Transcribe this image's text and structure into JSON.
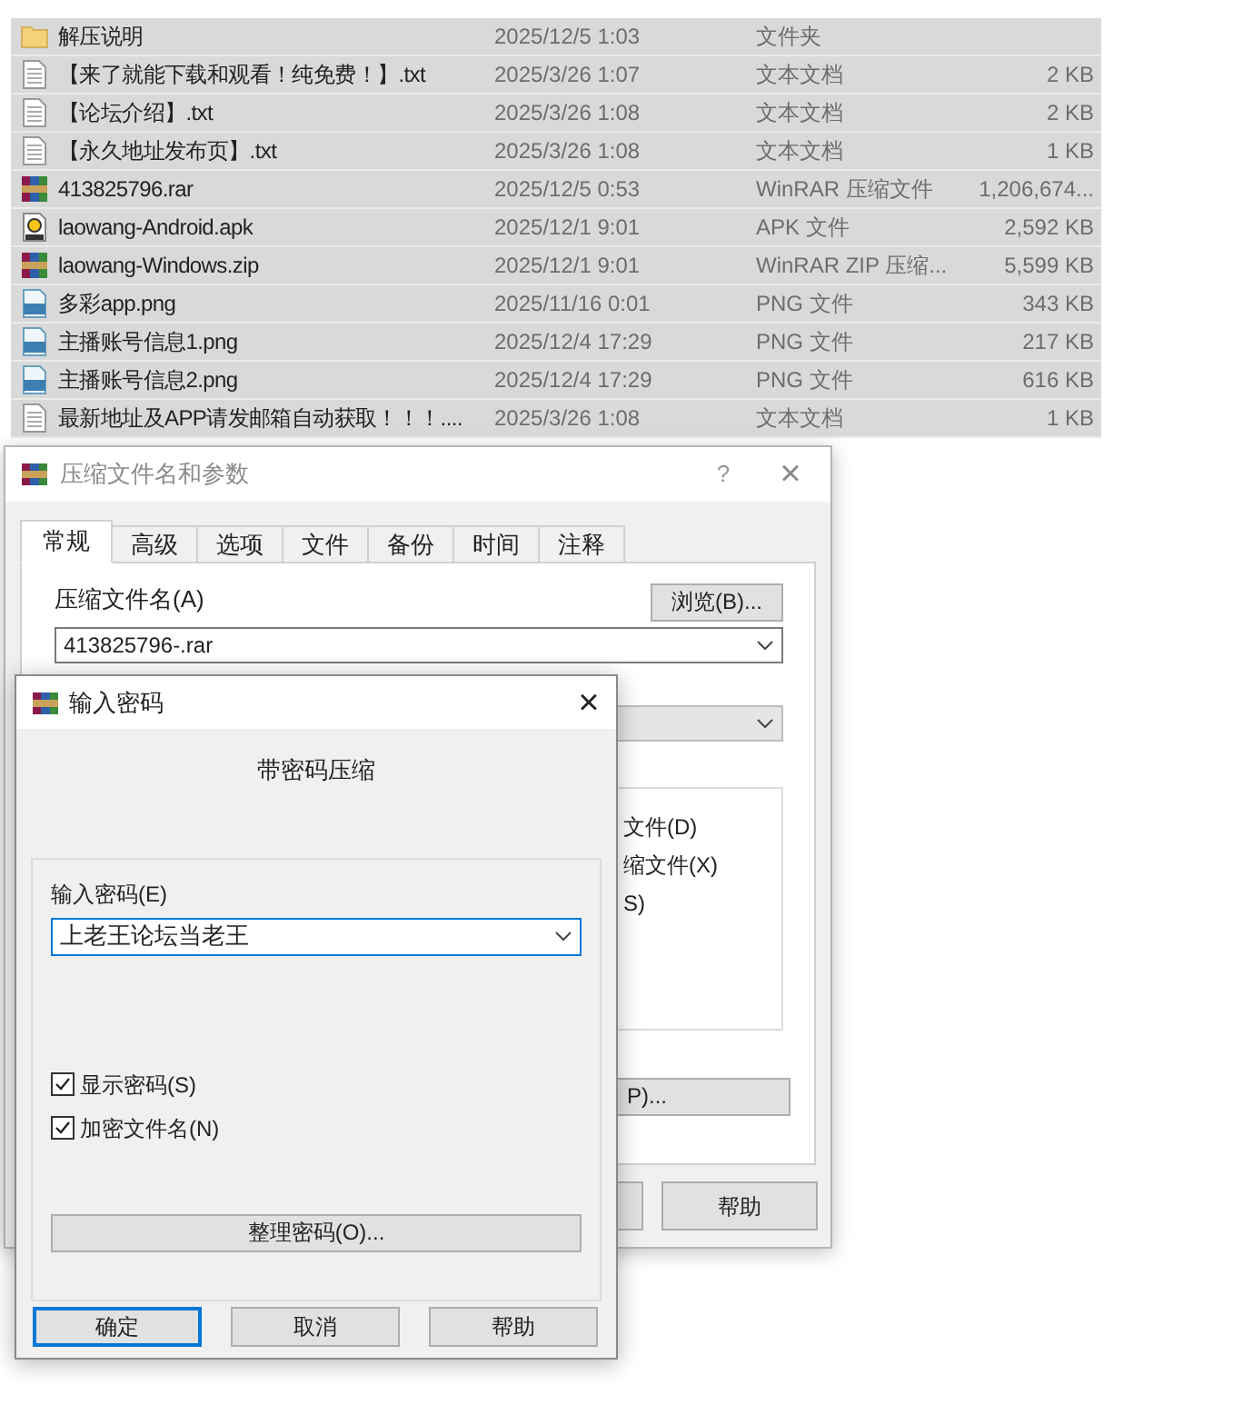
{
  "files": [
    {
      "kind": "folder",
      "name": "解压说明",
      "date": "2025/12/5 1:03",
      "type": "文件夹",
      "selected": true
    },
    {
      "kind": "text",
      "name": "【来了就能下载和观看！纯免费！】.txt",
      "date": "2025/3/26 1:07",
      "type": "文本文档",
      "size": "2 KB",
      "selected": true
    },
    {
      "kind": "text",
      "name": "【论坛介绍】.txt",
      "date": "2025/3/26 1:08",
      "type": "文本文档",
      "size": "2 KB",
      "selected": true
    },
    {
      "kind": "text",
      "name": "【永久地址发布页】.txt",
      "date": "2025/3/26 1:08",
      "type": "文本文档",
      "size": "1 KB",
      "selected": true
    },
    {
      "kind": "archive",
      "name": "413825796.rar",
      "date": "2025/12/5 0:53",
      "type": "WinRAR 压缩文件",
      "size": "1,206,674...",
      "selected": true
    },
    {
      "kind": "apk",
      "name": "laowang-Android.apk",
      "date": "2025/12/1 9:01",
      "type": "APK 文件",
      "size": "2,592 KB",
      "selected": true
    },
    {
      "kind": "archive",
      "name": "laowang-Windows.zip",
      "date": "2025/12/1 9:01",
      "type": "WinRAR ZIP 压缩...",
      "size": "5,599 KB",
      "selected": true
    },
    {
      "kind": "image",
      "name": "多彩app.png",
      "date": "2025/11/16 0:01",
      "type": "PNG 文件",
      "size": "343 KB",
      "selected": true
    },
    {
      "kind": "image",
      "name": "主播账号信息1.png",
      "date": "2025/12/4 17:29",
      "type": "PNG 文件",
      "size": "217 KB",
      "selected": true
    },
    {
      "kind": "image",
      "name": "主播账号信息2.png",
      "date": "2025/12/4 17:29",
      "type": "PNG 文件",
      "size": "616 KB",
      "selected": true
    },
    {
      "kind": "text",
      "name": "最新地址及APP请发邮箱自动获取！！！....",
      "date": "2025/3/26 1:08",
      "type": "文本文档",
      "size": "1 KB",
      "selected": true
    }
  ],
  "archive_dialog": {
    "title": "压缩文件名和参数",
    "help": "?",
    "close": "×",
    "tabs": [
      {
        "label": "常规",
        "selected": true
      },
      {
        "label": "高级",
        "selected": false
      },
      {
        "label": "选项",
        "selected": false
      },
      {
        "label": "文件",
        "selected": false
      },
      {
        "label": "备份",
        "selected": false
      },
      {
        "label": "时间",
        "selected": false
      },
      {
        "label": "注释",
        "selected": false
      }
    ],
    "archive_name_label": "压缩文件名(A)",
    "browse_button": "浏览(B)...",
    "archive_name": "413825796-.rar",
    "options_fragments": [
      "文件(D)",
      "缩文件(X)",
      "S)"
    ],
    "partial_button": "P)...",
    "help_button": "帮助"
  },
  "password_dialog": {
    "title": "输入密码",
    "close": "×",
    "heading": "带密码压缩",
    "password_label": "输入密码(E)",
    "password": "上老王论坛当老王",
    "checkboxes": [
      {
        "label": "显示密码(S)",
        "checked": true
      },
      {
        "label": "加密文件名(N)",
        "checked": true
      }
    ],
    "organize_button": "整理密码(O)...",
    "buttons": [
      {
        "label": "确定",
        "selected": true
      },
      {
        "label": "取消",
        "selected": false
      },
      {
        "label": "帮助",
        "selected": false
      }
    ]
  }
}
